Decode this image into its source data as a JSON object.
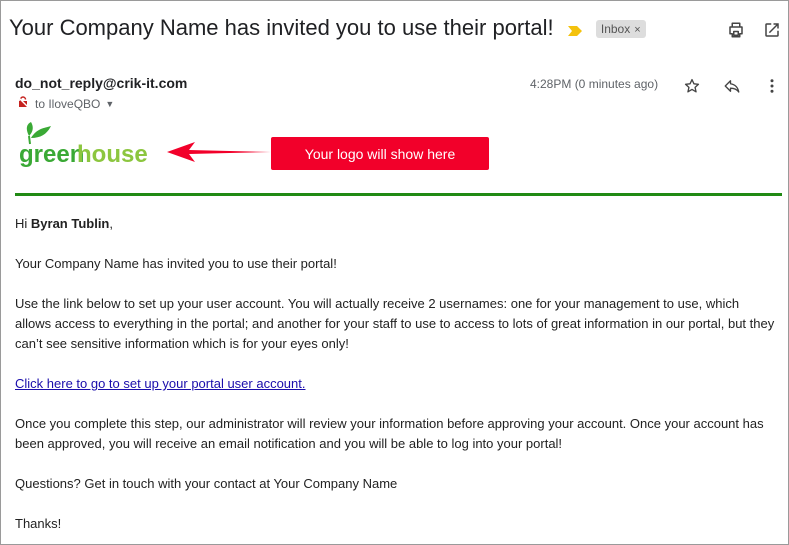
{
  "email": {
    "subject_company": "Your Company Name",
    "subject_rest": "has invited you to use their portal!",
    "label": "Inbox",
    "label_remove": "×",
    "sender": "do_not_reply@crik-it.com",
    "recipient": "to IloveQBO",
    "time": "4:28PM (0 minutes ago)"
  },
  "branding": {
    "logo_text_green": "green",
    "logo_text_house": "house",
    "callout": "Your logo will show here"
  },
  "body": {
    "greeting_prefix": "Hi ",
    "recipient_name": "Byran Tublin",
    "greeting_suffix": ",",
    "p1": "Your Company Name has invited you to use their portal!",
    "p2": "Use the link below to set up your user account. You will actually receive 2 usernames: one for your management to use, which allows access to everything in the portal; and another for your staff to use to access to lots of great information in our portal, but they can’t see sensitive information which is for your eyes only!",
    "link": "Click here to go to set up your portal user account.",
    "p3": "Once you complete this step, our administrator will review your information before approving your account. Once your account has been approved, you will receive an email notification and you will be able to log into your portal!",
    "p4": "Questions? Get in touch with your contact at Your Company Name",
    "p5": "Thanks!"
  },
  "colors": {
    "accent_green": "#218a14",
    "callout_red": "#f2002a",
    "importance_yellow": "#f4c20d"
  },
  "icons": [
    "importance-marker-icon",
    "print-icon",
    "open-in-new-window-icon",
    "not-encrypted-icon",
    "star-icon",
    "reply-icon",
    "more-vert-icon"
  ]
}
